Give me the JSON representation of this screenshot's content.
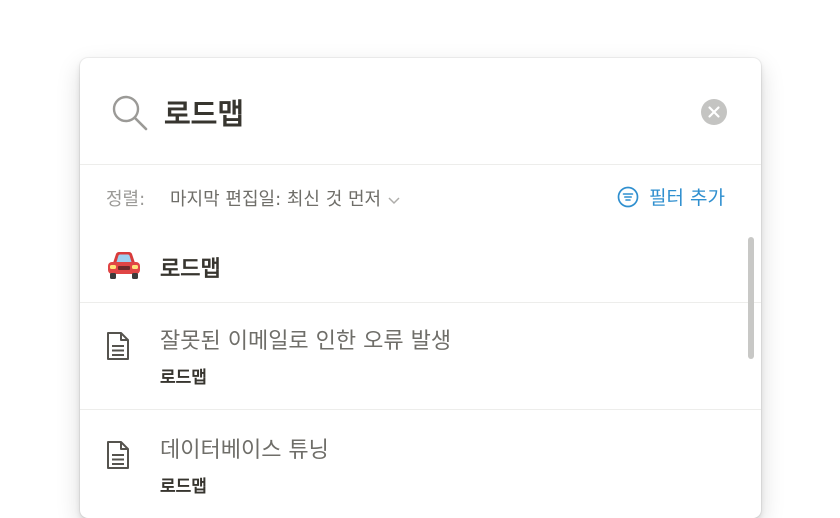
{
  "search": {
    "query": "로드맵",
    "icon": "search-icon",
    "clear_icon": "close-circle-icon"
  },
  "sort": {
    "label": "정렬:",
    "value": "마지막 편집일: 최신 것 먼저",
    "icon": "chevron-down-icon"
  },
  "filter": {
    "label": "필터 추가",
    "icon": "filter-icon",
    "color": "#2f8fcf"
  },
  "results": [
    {
      "icon": "car-emoji-icon",
      "title": "로드맵",
      "subtitle": ""
    },
    {
      "icon": "page-icon",
      "title": "잘못된 이메일로 인한 오류 발생",
      "subtitle": "로드맵"
    },
    {
      "icon": "page-icon",
      "title": "데이터베이스 튜닝",
      "subtitle": "로드맵"
    }
  ]
}
